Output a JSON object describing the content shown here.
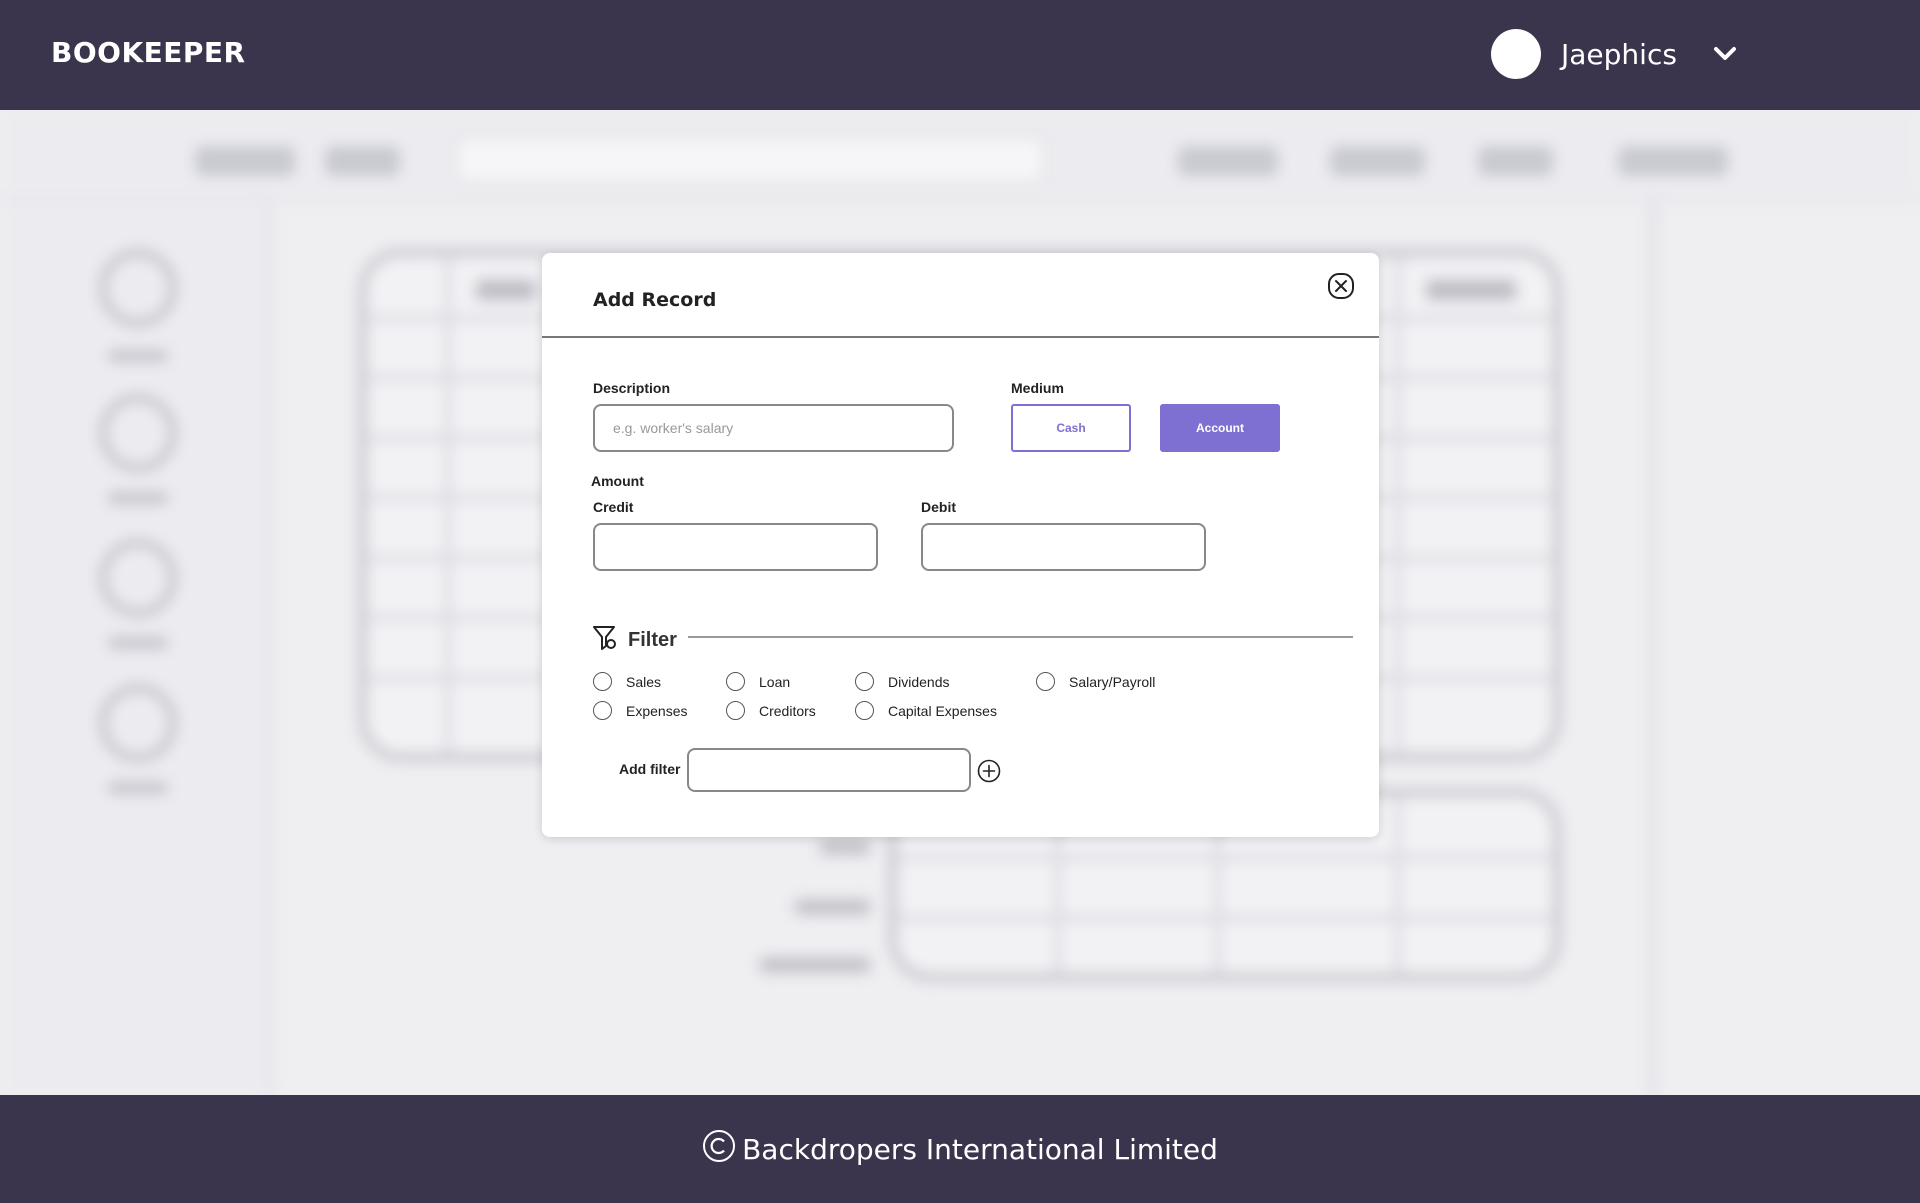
{
  "header": {
    "brand": "BOOKEEPER",
    "username": "Jaephics",
    "menu_icon": "chevron-down-icon"
  },
  "modal": {
    "title": "Add Record",
    "close_icon": "close-icon",
    "description": {
      "label": "Description",
      "placeholder": "e.g. worker's salary",
      "value": ""
    },
    "medium": {
      "label": "Medium",
      "options": [
        "Cash",
        "Account"
      ],
      "selected": "Account"
    },
    "amount": {
      "label": "Amount",
      "credit_label": "Credit",
      "credit_value": "",
      "debit_label": "Debit",
      "debit_value": ""
    },
    "filter": {
      "title": "Filter",
      "icon": "filter-icon",
      "options": [
        "Sales",
        "Loan",
        "Dividends",
        "Salary/Payroll",
        "Expenses",
        "Creditors",
        "Capital Expenses"
      ],
      "add_filter_label": "Add filter",
      "add_filter_value": "",
      "add_icon": "plus-circle-icon"
    }
  },
  "footer": {
    "copyright_icon": "copyright-icon",
    "text": "Backdropers International Limited"
  },
  "colors": {
    "header_bg": "#3a354d",
    "accent": "#7e6fd3"
  }
}
